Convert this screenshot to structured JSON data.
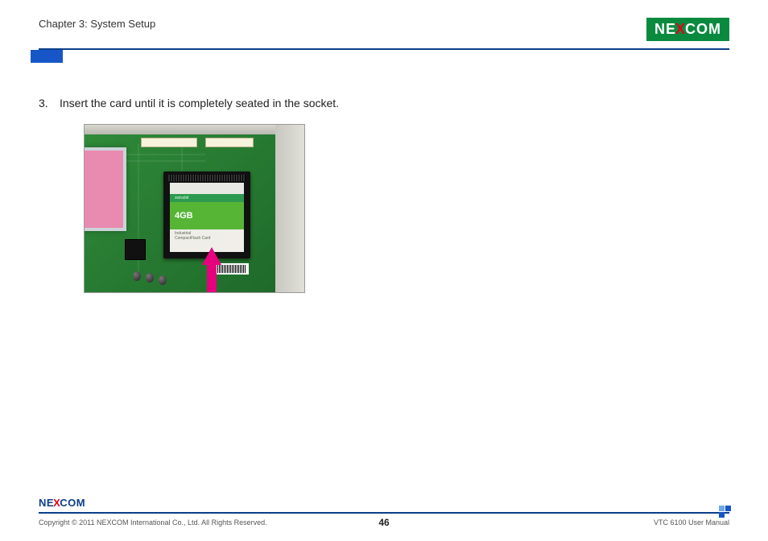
{
  "header": {
    "chapter": "Chapter 3: System Setup",
    "brand_ne": "NE",
    "brand_x": "X",
    "brand_com": "COM"
  },
  "instruction": {
    "number": "3.",
    "text": "Insert the card until it is completely seated in the socket."
  },
  "photo": {
    "cf_capacity": "4GB",
    "cf_brand": "swissbit",
    "cf_label_line1": "Industrial",
    "cf_label_line2": "CompactFlash Card"
  },
  "footer": {
    "copyright": "Copyright © 2011 NEXCOM International Co., Ltd. All Rights Reserved.",
    "page_number": "46",
    "manual": "VTC 6100 User Manual"
  }
}
